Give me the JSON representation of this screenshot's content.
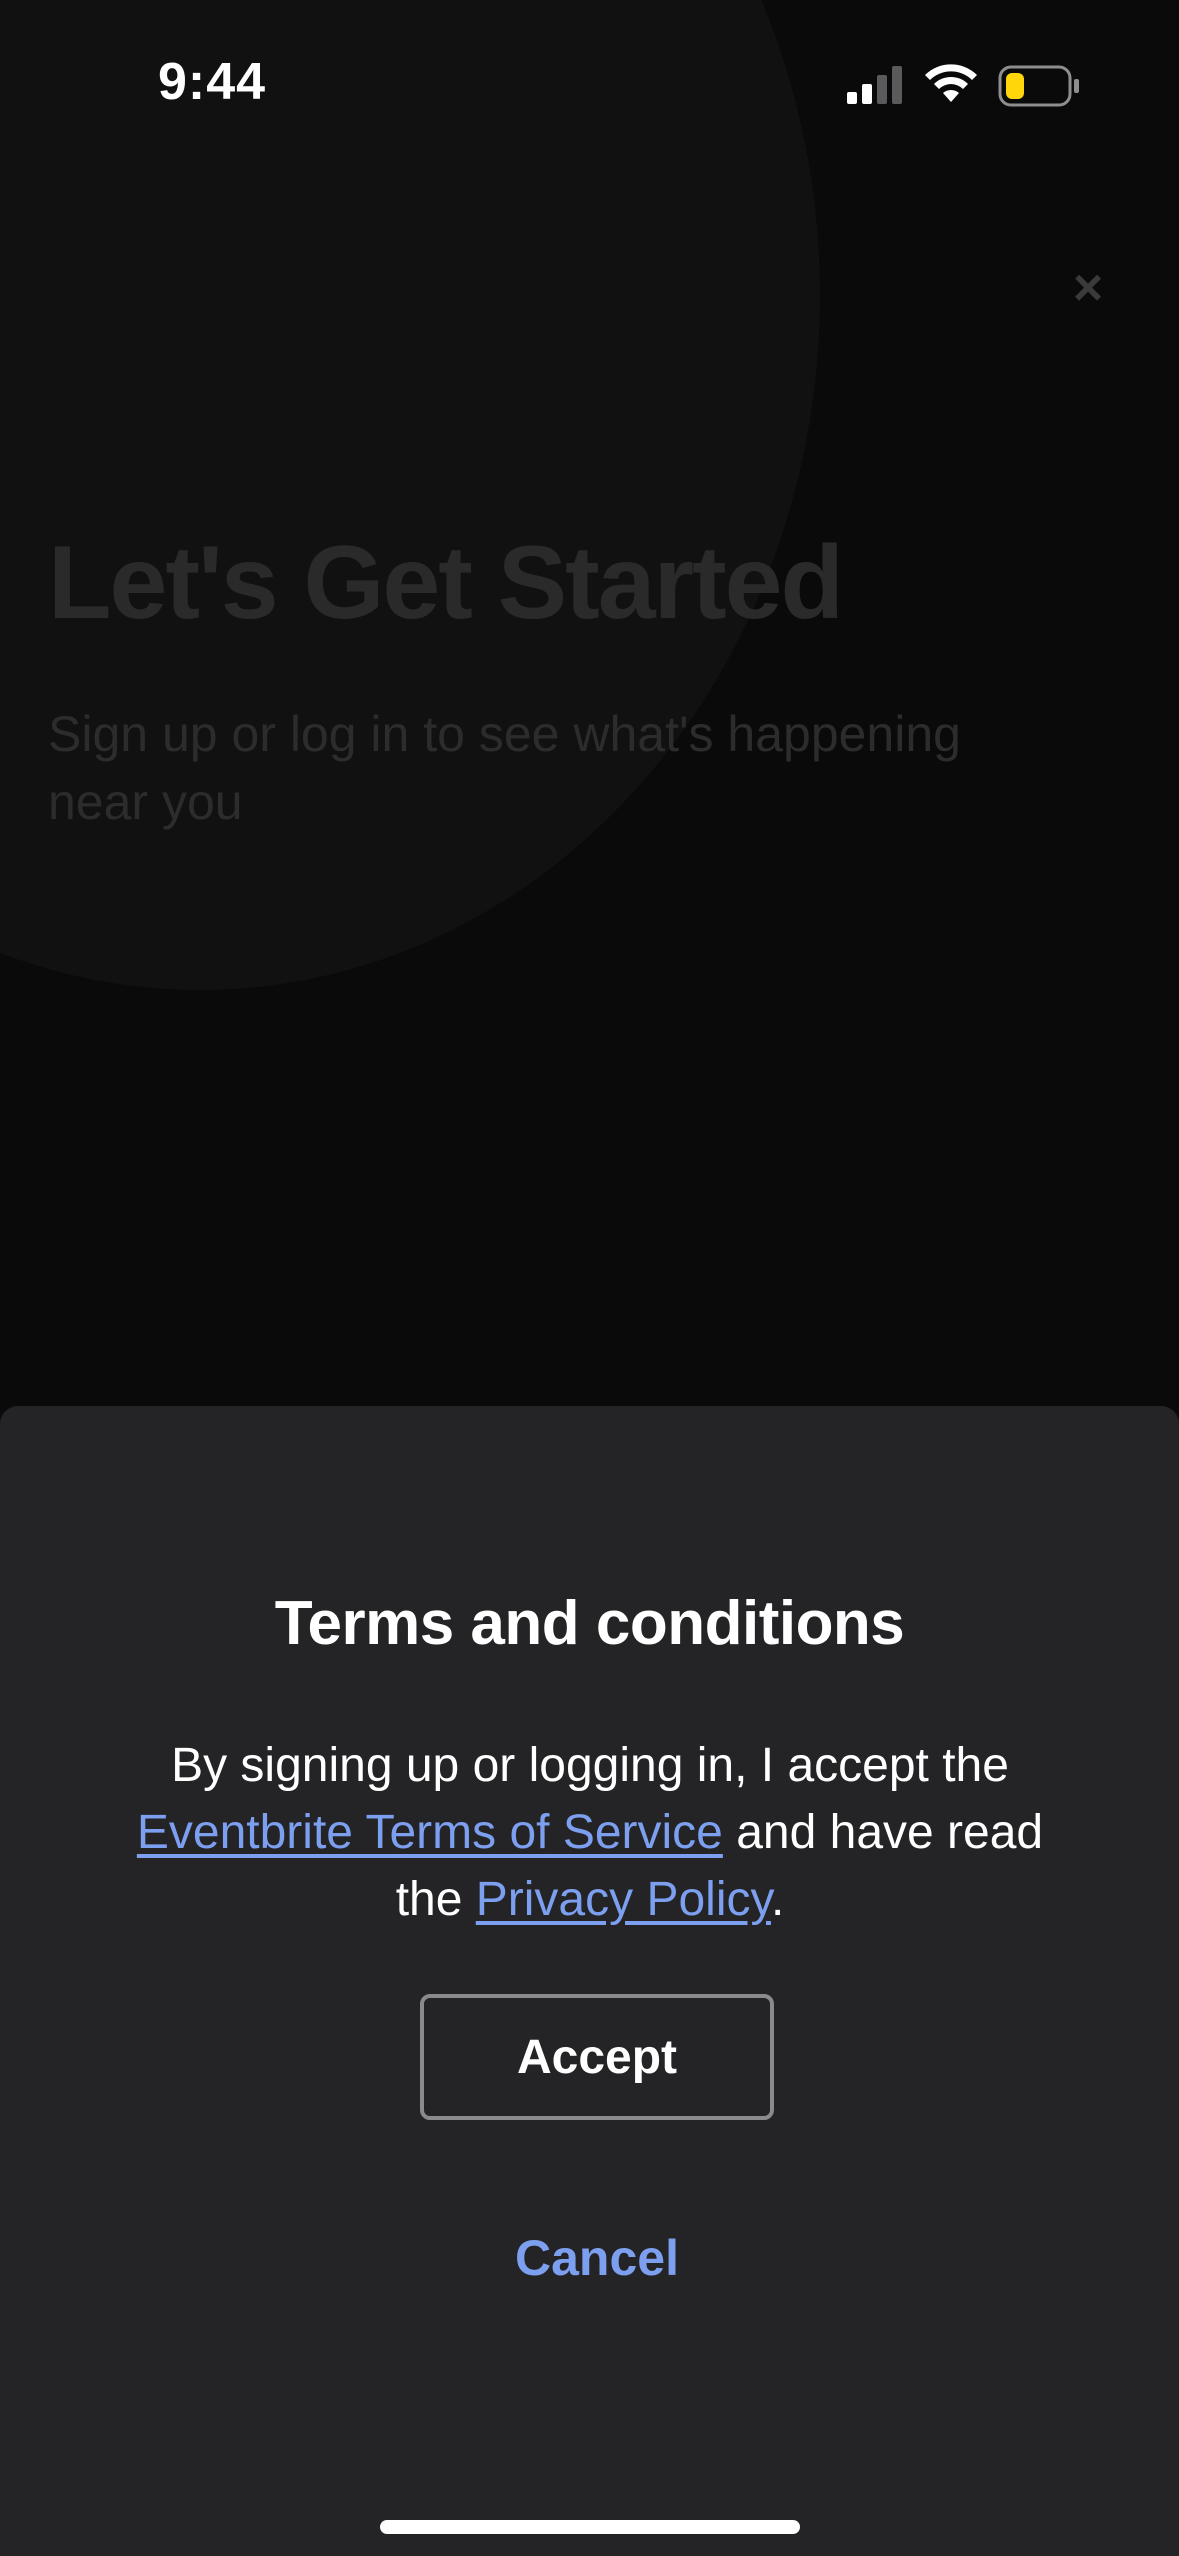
{
  "status_bar": {
    "time": "9:44",
    "icons": [
      "signal-icon",
      "wifi-icon",
      "battery-icon"
    ],
    "battery_color": "#ffd60a"
  },
  "background": {
    "close_symbol": "×",
    "title": "Let's Get Started",
    "subtitle": "Sign up or log in to see what's happening near you"
  },
  "sheet": {
    "title": "Terms and conditions",
    "body_prefix": "By signing up or logging in, I accept the ",
    "terms_link": "Eventbrite Terms of Service",
    "body_middle": " and have read the ",
    "privacy_link": "Privacy Policy",
    "body_suffix": ".",
    "accept_label": "Accept",
    "cancel_label": "Cancel"
  },
  "colors": {
    "sheet_background": "#242426",
    "link": "#7c9ff0",
    "page_background": "#0a0a0a"
  }
}
